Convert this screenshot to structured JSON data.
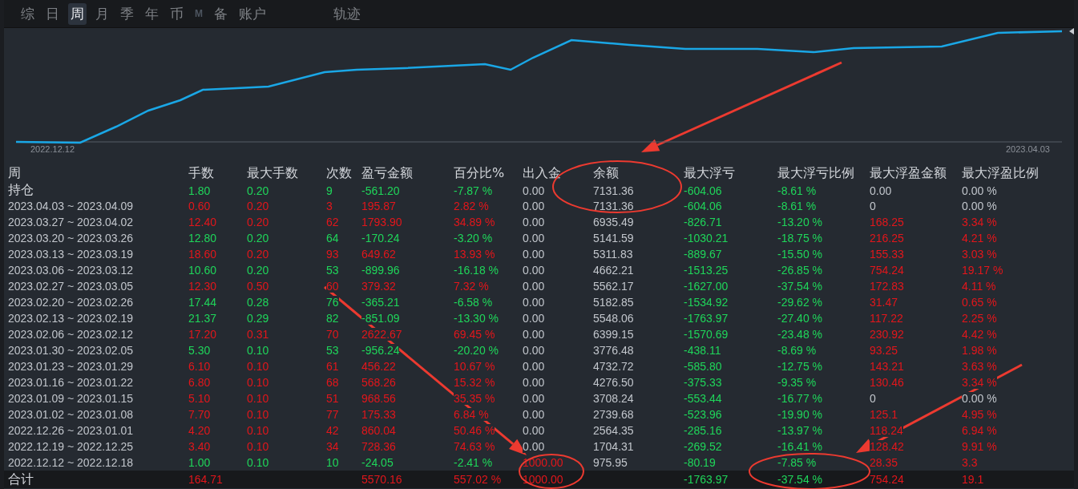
{
  "tabs": [
    {
      "label": "综",
      "selected": false
    },
    {
      "label": "日",
      "selected": false
    },
    {
      "label": "周",
      "selected": true
    },
    {
      "label": "月",
      "selected": false
    },
    {
      "label": "季",
      "selected": false
    },
    {
      "label": "年",
      "selected": false
    },
    {
      "label": "币",
      "selected": false
    },
    {
      "label": "M",
      "selected": false
    },
    {
      "label": "备",
      "selected": false
    },
    {
      "label": "账户",
      "selected": false
    }
  ],
  "track_tab": {
    "label": "轨迹",
    "selected": false
  },
  "chart": {
    "start_label": "2022.12.12",
    "end_label": "2023.04.03"
  },
  "table": {
    "columns": [
      "周",
      "手数",
      "最大手数",
      "次数",
      "盈亏金额",
      "百分比%",
      "出入金",
      "余额",
      "最大浮亏",
      "最大浮亏比例",
      "最大浮盈金额",
      "最大浮盈比例"
    ],
    "rows": [
      {
        "kind": "position",
        "cells": [
          {
            "text": "持仓"
          },
          {
            "text": "1.80",
            "color": "#1fd65a"
          },
          {
            "text": "0.20",
            "color": "#1fd65a"
          },
          {
            "text": "9",
            "color": "#1fd65a"
          },
          {
            "text": "-561.20",
            "color": "#1fd65a"
          },
          {
            "text": "-7.87 %",
            "color": "#1fd65a"
          },
          {
            "text": "0.00",
            "color": "#c2c6cc"
          },
          {
            "text": "7131.36",
            "color": "#c2c6cc"
          },
          {
            "text": "-604.06",
            "color": "#1fd65a"
          },
          {
            "text": "-8.61 %",
            "color": "#1fd65a"
          },
          {
            "text": "0.00",
            "color": "#c2c6cc"
          },
          {
            "text": "0.00 %",
            "color": "#c2c6cc"
          }
        ]
      },
      {
        "kind": "week",
        "cells": [
          {
            "text": "2023.04.03 ~ 2023.04.09"
          },
          {
            "text": "0.60",
            "color": "#e3161b"
          },
          {
            "text": "0.20",
            "color": "#e3161b"
          },
          {
            "text": "3",
            "color": "#e3161b"
          },
          {
            "text": "195.87",
            "color": "#e3161b"
          },
          {
            "text": "2.82 %",
            "color": "#e3161b"
          },
          {
            "text": "0.00",
            "color": "#c2c6cc"
          },
          {
            "text": "7131.36",
            "color": "#c2c6cc"
          },
          {
            "text": "-604.06",
            "color": "#1fd65a"
          },
          {
            "text": "-8.61 %",
            "color": "#1fd65a"
          },
          {
            "text": "0",
            "color": "#c2c6cc"
          },
          {
            "text": "0.00 %",
            "color": "#c2c6cc"
          }
        ]
      },
      {
        "kind": "week",
        "cells": [
          {
            "text": "2023.03.27 ~ 2023.04.02"
          },
          {
            "text": "12.40",
            "color": "#e3161b"
          },
          {
            "text": "0.20",
            "color": "#e3161b"
          },
          {
            "text": "62",
            "color": "#e3161b"
          },
          {
            "text": "1793.90",
            "color": "#e3161b"
          },
          {
            "text": "34.89 %",
            "color": "#e3161b"
          },
          {
            "text": "0.00",
            "color": "#c2c6cc"
          },
          {
            "text": "6935.49",
            "color": "#c2c6cc"
          },
          {
            "text": "-826.71",
            "color": "#1fd65a"
          },
          {
            "text": "-13.20 %",
            "color": "#1fd65a"
          },
          {
            "text": "168.25",
            "color": "#e3161b"
          },
          {
            "text": "3.34 %",
            "color": "#e3161b"
          }
        ]
      },
      {
        "kind": "week",
        "cells": [
          {
            "text": "2023.03.20 ~ 2023.03.26"
          },
          {
            "text": "12.80",
            "color": "#1fd65a"
          },
          {
            "text": "0.20",
            "color": "#1fd65a"
          },
          {
            "text": "64",
            "color": "#1fd65a"
          },
          {
            "text": "-170.24",
            "color": "#1fd65a"
          },
          {
            "text": "-3.20 %",
            "color": "#1fd65a"
          },
          {
            "text": "0.00",
            "color": "#c2c6cc"
          },
          {
            "text": "5141.59",
            "color": "#c2c6cc"
          },
          {
            "text": "-1030.21",
            "color": "#1fd65a"
          },
          {
            "text": "-18.75 %",
            "color": "#1fd65a"
          },
          {
            "text": "216.25",
            "color": "#e3161b"
          },
          {
            "text": "4.21 %",
            "color": "#e3161b"
          }
        ]
      },
      {
        "kind": "week",
        "cells": [
          {
            "text": "2023.03.13 ~ 2023.03.19"
          },
          {
            "text": "18.60",
            "color": "#e3161b"
          },
          {
            "text": "0.20",
            "color": "#e3161b"
          },
          {
            "text": "93",
            "color": "#e3161b"
          },
          {
            "text": "649.62",
            "color": "#e3161b"
          },
          {
            "text": "13.93 %",
            "color": "#e3161b"
          },
          {
            "text": "0.00",
            "color": "#c2c6cc"
          },
          {
            "text": "5311.83",
            "color": "#c2c6cc"
          },
          {
            "text": "-889.67",
            "color": "#1fd65a"
          },
          {
            "text": "-15.50 %",
            "color": "#1fd65a"
          },
          {
            "text": "155.33",
            "color": "#e3161b"
          },
          {
            "text": "3.03 %",
            "color": "#e3161b"
          }
        ]
      },
      {
        "kind": "week",
        "cells": [
          {
            "text": "2023.03.06 ~ 2023.03.12"
          },
          {
            "text": "10.60",
            "color": "#1fd65a"
          },
          {
            "text": "0.20",
            "color": "#1fd65a"
          },
          {
            "text": "53",
            "color": "#1fd65a"
          },
          {
            "text": "-899.96",
            "color": "#1fd65a"
          },
          {
            "text": "-16.18 %",
            "color": "#1fd65a"
          },
          {
            "text": "0.00",
            "color": "#c2c6cc"
          },
          {
            "text": "4662.21",
            "color": "#c2c6cc"
          },
          {
            "text": "-1513.25",
            "color": "#1fd65a"
          },
          {
            "text": "-26.85 %",
            "color": "#1fd65a"
          },
          {
            "text": "754.24",
            "color": "#e3161b"
          },
          {
            "text": "19.17 %",
            "color": "#e3161b"
          }
        ]
      },
      {
        "kind": "week",
        "cells": [
          {
            "text": "2023.02.27 ~ 2023.03.05"
          },
          {
            "text": "12.30",
            "color": "#e3161b"
          },
          {
            "text": "0.50",
            "color": "#e3161b"
          },
          {
            "text": "60",
            "color": "#e3161b"
          },
          {
            "text": "379.32",
            "color": "#e3161b"
          },
          {
            "text": "7.32 %",
            "color": "#e3161b"
          },
          {
            "text": "0.00",
            "color": "#c2c6cc"
          },
          {
            "text": "5562.17",
            "color": "#c2c6cc"
          },
          {
            "text": "-1627.00",
            "color": "#1fd65a"
          },
          {
            "text": "-37.54 %",
            "color": "#1fd65a"
          },
          {
            "text": "172.83",
            "color": "#e3161b"
          },
          {
            "text": "4.11 %",
            "color": "#e3161b"
          }
        ]
      },
      {
        "kind": "week",
        "cells": [
          {
            "text": "2023.02.20 ~ 2023.02.26"
          },
          {
            "text": "17.44",
            "color": "#1fd65a"
          },
          {
            "text": "0.28",
            "color": "#1fd65a"
          },
          {
            "text": "76",
            "color": "#1fd65a"
          },
          {
            "text": "-365.21",
            "color": "#1fd65a"
          },
          {
            "text": "-6.58 %",
            "color": "#1fd65a"
          },
          {
            "text": "0.00",
            "color": "#c2c6cc"
          },
          {
            "text": "5182.85",
            "color": "#c2c6cc"
          },
          {
            "text": "-1534.92",
            "color": "#1fd65a"
          },
          {
            "text": "-29.62 %",
            "color": "#1fd65a"
          },
          {
            "text": "31.47",
            "color": "#e3161b"
          },
          {
            "text": "0.65 %",
            "color": "#e3161b"
          }
        ]
      },
      {
        "kind": "week",
        "cells": [
          {
            "text": "2023.02.13 ~ 2023.02.19"
          },
          {
            "text": "21.37",
            "color": "#1fd65a"
          },
          {
            "text": "0.29",
            "color": "#1fd65a"
          },
          {
            "text": "82",
            "color": "#1fd65a"
          },
          {
            "text": "-851.09",
            "color": "#1fd65a"
          },
          {
            "text": "-13.30 %",
            "color": "#1fd65a"
          },
          {
            "text": "0.00",
            "color": "#c2c6cc"
          },
          {
            "text": "5548.06",
            "color": "#c2c6cc"
          },
          {
            "text": "-1763.97",
            "color": "#1fd65a"
          },
          {
            "text": "-27.40 %",
            "color": "#1fd65a"
          },
          {
            "text": "117.22",
            "color": "#e3161b"
          },
          {
            "text": "2.25 %",
            "color": "#e3161b"
          }
        ]
      },
      {
        "kind": "week",
        "cells": [
          {
            "text": "2023.02.06 ~ 2023.02.12"
          },
          {
            "text": "17.20",
            "color": "#e3161b"
          },
          {
            "text": "0.31",
            "color": "#e3161b"
          },
          {
            "text": "70",
            "color": "#e3161b"
          },
          {
            "text": "2622.67",
            "color": "#e3161b"
          },
          {
            "text": "69.45 %",
            "color": "#e3161b"
          },
          {
            "text": "0.00",
            "color": "#c2c6cc"
          },
          {
            "text": "6399.15",
            "color": "#c2c6cc"
          },
          {
            "text": "-1570.69",
            "color": "#1fd65a"
          },
          {
            "text": "-23.48 %",
            "color": "#1fd65a"
          },
          {
            "text": "230.92",
            "color": "#e3161b"
          },
          {
            "text": "4.42 %",
            "color": "#e3161b"
          }
        ]
      },
      {
        "kind": "week",
        "cells": [
          {
            "text": "2023.01.30 ~ 2023.02.05"
          },
          {
            "text": "5.30",
            "color": "#1fd65a"
          },
          {
            "text": "0.10",
            "color": "#1fd65a"
          },
          {
            "text": "53",
            "color": "#1fd65a"
          },
          {
            "text": "-956.24",
            "color": "#1fd65a"
          },
          {
            "text": "-20.20 %",
            "color": "#1fd65a"
          },
          {
            "text": "0.00",
            "color": "#c2c6cc"
          },
          {
            "text": "3776.48",
            "color": "#c2c6cc"
          },
          {
            "text": "-438.11",
            "color": "#1fd65a"
          },
          {
            "text": "-8.69 %",
            "color": "#1fd65a"
          },
          {
            "text": "93.25",
            "color": "#e3161b"
          },
          {
            "text": "1.98 %",
            "color": "#e3161b"
          }
        ]
      },
      {
        "kind": "week",
        "cells": [
          {
            "text": "2023.01.23 ~ 2023.01.29"
          },
          {
            "text": "6.10",
            "color": "#e3161b"
          },
          {
            "text": "0.10",
            "color": "#e3161b"
          },
          {
            "text": "61",
            "color": "#e3161b"
          },
          {
            "text": "456.22",
            "color": "#e3161b"
          },
          {
            "text": "10.67 %",
            "color": "#e3161b"
          },
          {
            "text": "0.00",
            "color": "#c2c6cc"
          },
          {
            "text": "4732.72",
            "color": "#c2c6cc"
          },
          {
            "text": "-585.80",
            "color": "#1fd65a"
          },
          {
            "text": "-12.75 %",
            "color": "#1fd65a"
          },
          {
            "text": "143.21",
            "color": "#e3161b"
          },
          {
            "text": "3.63 %",
            "color": "#e3161b"
          }
        ]
      },
      {
        "kind": "week",
        "cells": [
          {
            "text": "2023.01.16 ~ 2023.01.22"
          },
          {
            "text": "6.80",
            "color": "#e3161b"
          },
          {
            "text": "0.10",
            "color": "#e3161b"
          },
          {
            "text": "68",
            "color": "#e3161b"
          },
          {
            "text": "568.26",
            "color": "#e3161b"
          },
          {
            "text": "15.32 %",
            "color": "#e3161b"
          },
          {
            "text": "0.00",
            "color": "#c2c6cc"
          },
          {
            "text": "4276.50",
            "color": "#c2c6cc"
          },
          {
            "text": "-375.33",
            "color": "#1fd65a"
          },
          {
            "text": "-9.35 %",
            "color": "#1fd65a"
          },
          {
            "text": "130.46",
            "color": "#e3161b"
          },
          {
            "text": "3.34 %",
            "color": "#e3161b"
          }
        ]
      },
      {
        "kind": "week",
        "cells": [
          {
            "text": "2023.01.09 ~ 2023.01.15"
          },
          {
            "text": "5.10",
            "color": "#e3161b"
          },
          {
            "text": "0.10",
            "color": "#e3161b"
          },
          {
            "text": "51",
            "color": "#e3161b"
          },
          {
            "text": "968.56",
            "color": "#e3161b"
          },
          {
            "text": "35.35 %",
            "color": "#e3161b"
          },
          {
            "text": "0.00",
            "color": "#c2c6cc"
          },
          {
            "text": "3708.24",
            "color": "#c2c6cc"
          },
          {
            "text": "-553.44",
            "color": "#1fd65a"
          },
          {
            "text": "-16.77 %",
            "color": "#1fd65a"
          },
          {
            "text": "0",
            "color": "#c2c6cc"
          },
          {
            "text": "0.00 %",
            "color": "#c2c6cc"
          }
        ]
      },
      {
        "kind": "week",
        "cells": [
          {
            "text": "2023.01.02 ~ 2023.01.08"
          },
          {
            "text": "7.70",
            "color": "#e3161b"
          },
          {
            "text": "0.10",
            "color": "#e3161b"
          },
          {
            "text": "77",
            "color": "#e3161b"
          },
          {
            "text": "175.33",
            "color": "#e3161b"
          },
          {
            "text": "6.84 %",
            "color": "#e3161b"
          },
          {
            "text": "0.00",
            "color": "#c2c6cc"
          },
          {
            "text": "2739.68",
            "color": "#c2c6cc"
          },
          {
            "text": "-523.96",
            "color": "#1fd65a"
          },
          {
            "text": "-19.90 %",
            "color": "#1fd65a"
          },
          {
            "text": "125.1",
            "color": "#e3161b"
          },
          {
            "text": "4.95 %",
            "color": "#e3161b"
          }
        ]
      },
      {
        "kind": "week",
        "cells": [
          {
            "text": "2022.12.26 ~ 2023.01.01"
          },
          {
            "text": "4.20",
            "color": "#e3161b"
          },
          {
            "text": "0.10",
            "color": "#e3161b"
          },
          {
            "text": "42",
            "color": "#e3161b"
          },
          {
            "text": "860.04",
            "color": "#e3161b"
          },
          {
            "text": "50.46 %",
            "color": "#e3161b"
          },
          {
            "text": "0.00",
            "color": "#c2c6cc"
          },
          {
            "text": "2564.35",
            "color": "#c2c6cc"
          },
          {
            "text": "-285.16",
            "color": "#1fd65a"
          },
          {
            "text": "-13.97 %",
            "color": "#1fd65a"
          },
          {
            "text": "118.24",
            "color": "#e3161b"
          },
          {
            "text": "6.94 %",
            "color": "#e3161b"
          }
        ]
      },
      {
        "kind": "week",
        "cells": [
          {
            "text": "2022.12.19 ~ 2022.12.25"
          },
          {
            "text": "3.40",
            "color": "#e3161b"
          },
          {
            "text": "0.10",
            "color": "#e3161b"
          },
          {
            "text": "34",
            "color": "#e3161b"
          },
          {
            "text": "728.36",
            "color": "#e3161b"
          },
          {
            "text": "74.63 %",
            "color": "#e3161b"
          },
          {
            "text": "0.00",
            "color": "#c2c6cc"
          },
          {
            "text": "1704.31",
            "color": "#c2c6cc"
          },
          {
            "text": "-269.52",
            "color": "#1fd65a"
          },
          {
            "text": "-16.41 %",
            "color": "#1fd65a"
          },
          {
            "text": "128.42",
            "color": "#e3161b"
          },
          {
            "text": "9.91 %",
            "color": "#e3161b"
          }
        ]
      },
      {
        "kind": "week",
        "cells": [
          {
            "text": "2022.12.12 ~ 2022.12.18"
          },
          {
            "text": "1.00",
            "color": "#1fd65a"
          },
          {
            "text": "0.10",
            "color": "#1fd65a"
          },
          {
            "text": "10",
            "color": "#1fd65a"
          },
          {
            "text": "-24.05",
            "color": "#1fd65a"
          },
          {
            "text": "-2.41 %",
            "color": "#1fd65a"
          },
          {
            "text": "1000.00",
            "color": "#e3161b"
          },
          {
            "text": "975.95",
            "color": "#c2c6cc"
          },
          {
            "text": "-80.19",
            "color": "#1fd65a"
          },
          {
            "text": "-7.85 %",
            "color": "#1fd65a"
          },
          {
            "text": "28.35",
            "color": "#e3161b"
          },
          {
            "text": "3.3",
            "color": "#e3161b"
          }
        ]
      },
      {
        "kind": "total",
        "cells": [
          {
            "text": "合计"
          },
          {
            "text": "164.71",
            "color": "#e3161b"
          },
          null,
          null,
          {
            "text": "5570.16",
            "color": "#e3161b"
          },
          {
            "text": "557.02 %",
            "color": "#e3161b"
          },
          {
            "text": "1000.00",
            "color": "#e3161b"
          },
          null,
          {
            "text": "-1763.97",
            "color": "#1fd65a"
          },
          {
            "text": "-37.54 %",
            "color": "#1fd65a"
          },
          {
            "text": "754.24",
            "color": "#e3161b"
          },
          {
            "text": "19.1",
            "color": "#e3161b"
          }
        ]
      }
    ]
  }
}
